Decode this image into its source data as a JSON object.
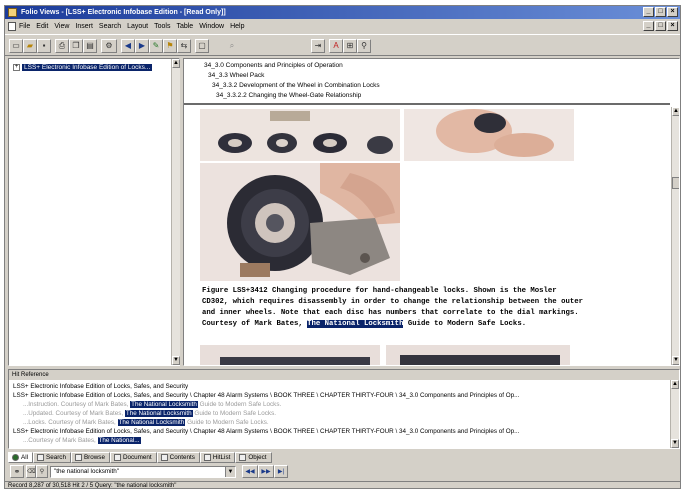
{
  "window": {
    "title": "Folio Views - [LSS+ Electronic Infobase Edition - [Read Only]]",
    "controls": [
      "_",
      "□",
      "×"
    ]
  },
  "menu": {
    "items": [
      "File",
      "Edit",
      "View",
      "Insert",
      "Search",
      "Layout",
      "Tools",
      "Table",
      "Window",
      "Help"
    ],
    "mdi_controls": [
      "_",
      "□",
      "×"
    ]
  },
  "tree": {
    "expander": "+",
    "selected_label": "LSS+ Electronic Infobase Edition of Locks..."
  },
  "document": {
    "breadcrumbs": [
      "34_3.0 Components and Principles of Operation",
      "34_3.3 Wheel Pack",
      "34_3.3.2 Development of the Wheel in Combination Locks",
      "34_3.3.2.2 Changing the Wheel-Gate Relationship"
    ],
    "caption": {
      "line1": "Figure LSS+3412 Changing procedure for hand-changeable locks. Shown is the Mosler",
      "line2": "CD302, which requires disassembly in order to change the relationship between the outer",
      "line3": "and inner wheels. Note that each disc has numbers that correlate to the dial markings.",
      "line4_pre": "Courtesy of Mark Bates,",
      "line4_hl": "The National Locksmith",
      "line4_post": "Guide to Modern Safe Locks."
    }
  },
  "hits": {
    "title": "Hit Reference",
    "rows": [
      {
        "text": "LSS+ Electronic Infobase Edition of Locks, Safes, and Security",
        "style": "normal"
      },
      {
        "text": "LSS+ Electronic Infobase Edition of Locks, Safes, and Security \\ Chapter 48 Alarm Systems \\ BOOK THREE \\ CHAPTER THIRTY-FOUR \\ 34_3.0 Components and Principles of Op...",
        "style": "normal"
      },
      {
        "pre": "...Instruction. Courtesy of Mark Bates,",
        "hl": "The National Locksmith",
        "post": "Guide to Modern Safe Locks.",
        "style": "dim"
      },
      {
        "pre": "...Updated. Courtesy of Mark Bates,",
        "hl": "The National Locksmith",
        "post": "Guide to Modern Safe Locks.",
        "style": "dim"
      },
      {
        "pre": "...Locks. Courtesy of Mark Bates,",
        "hl": "The National Locksmith",
        "post": "Guide to Modern Safe Locks.",
        "style": "dim"
      },
      {
        "text": "LSS+ Electronic Infobase Edition of Locks, Safes, and Security \\ Chapter 48 Alarm Systems \\ BOOK THREE \\ CHAPTER THIRTY-FOUR \\ 34_3.0 Components and Principles of Op...",
        "style": "normal"
      },
      {
        "pre": "...Courtesy of Mark Bates,",
        "hl": "The National...",
        "post": "",
        "style": "dim"
      }
    ]
  },
  "tabs": [
    {
      "label": "All",
      "icon": "all-icon",
      "active": true
    },
    {
      "label": "Search",
      "icon": "search-icon"
    },
    {
      "label": "Browse",
      "icon": "browse-icon"
    },
    {
      "label": "Document",
      "icon": "document-icon"
    },
    {
      "label": "Contents",
      "icon": "contents-icon"
    },
    {
      "label": "HitList",
      "icon": "hitlist-icon"
    },
    {
      "label": "Object",
      "icon": "object-icon"
    }
  ],
  "query": {
    "value": "\"the national locksmith\"",
    "nav_buttons": [
      "◀◀",
      "▶▶",
      "▶|"
    ]
  },
  "status": {
    "text": "Record 8,287 of 30,518   Hit 2 / 5   Query: \"the national locksmith\""
  },
  "colors": {
    "titlebar": "#1b3b9a",
    "selection": "#0a246a",
    "chrome": "#d4d0c8"
  }
}
